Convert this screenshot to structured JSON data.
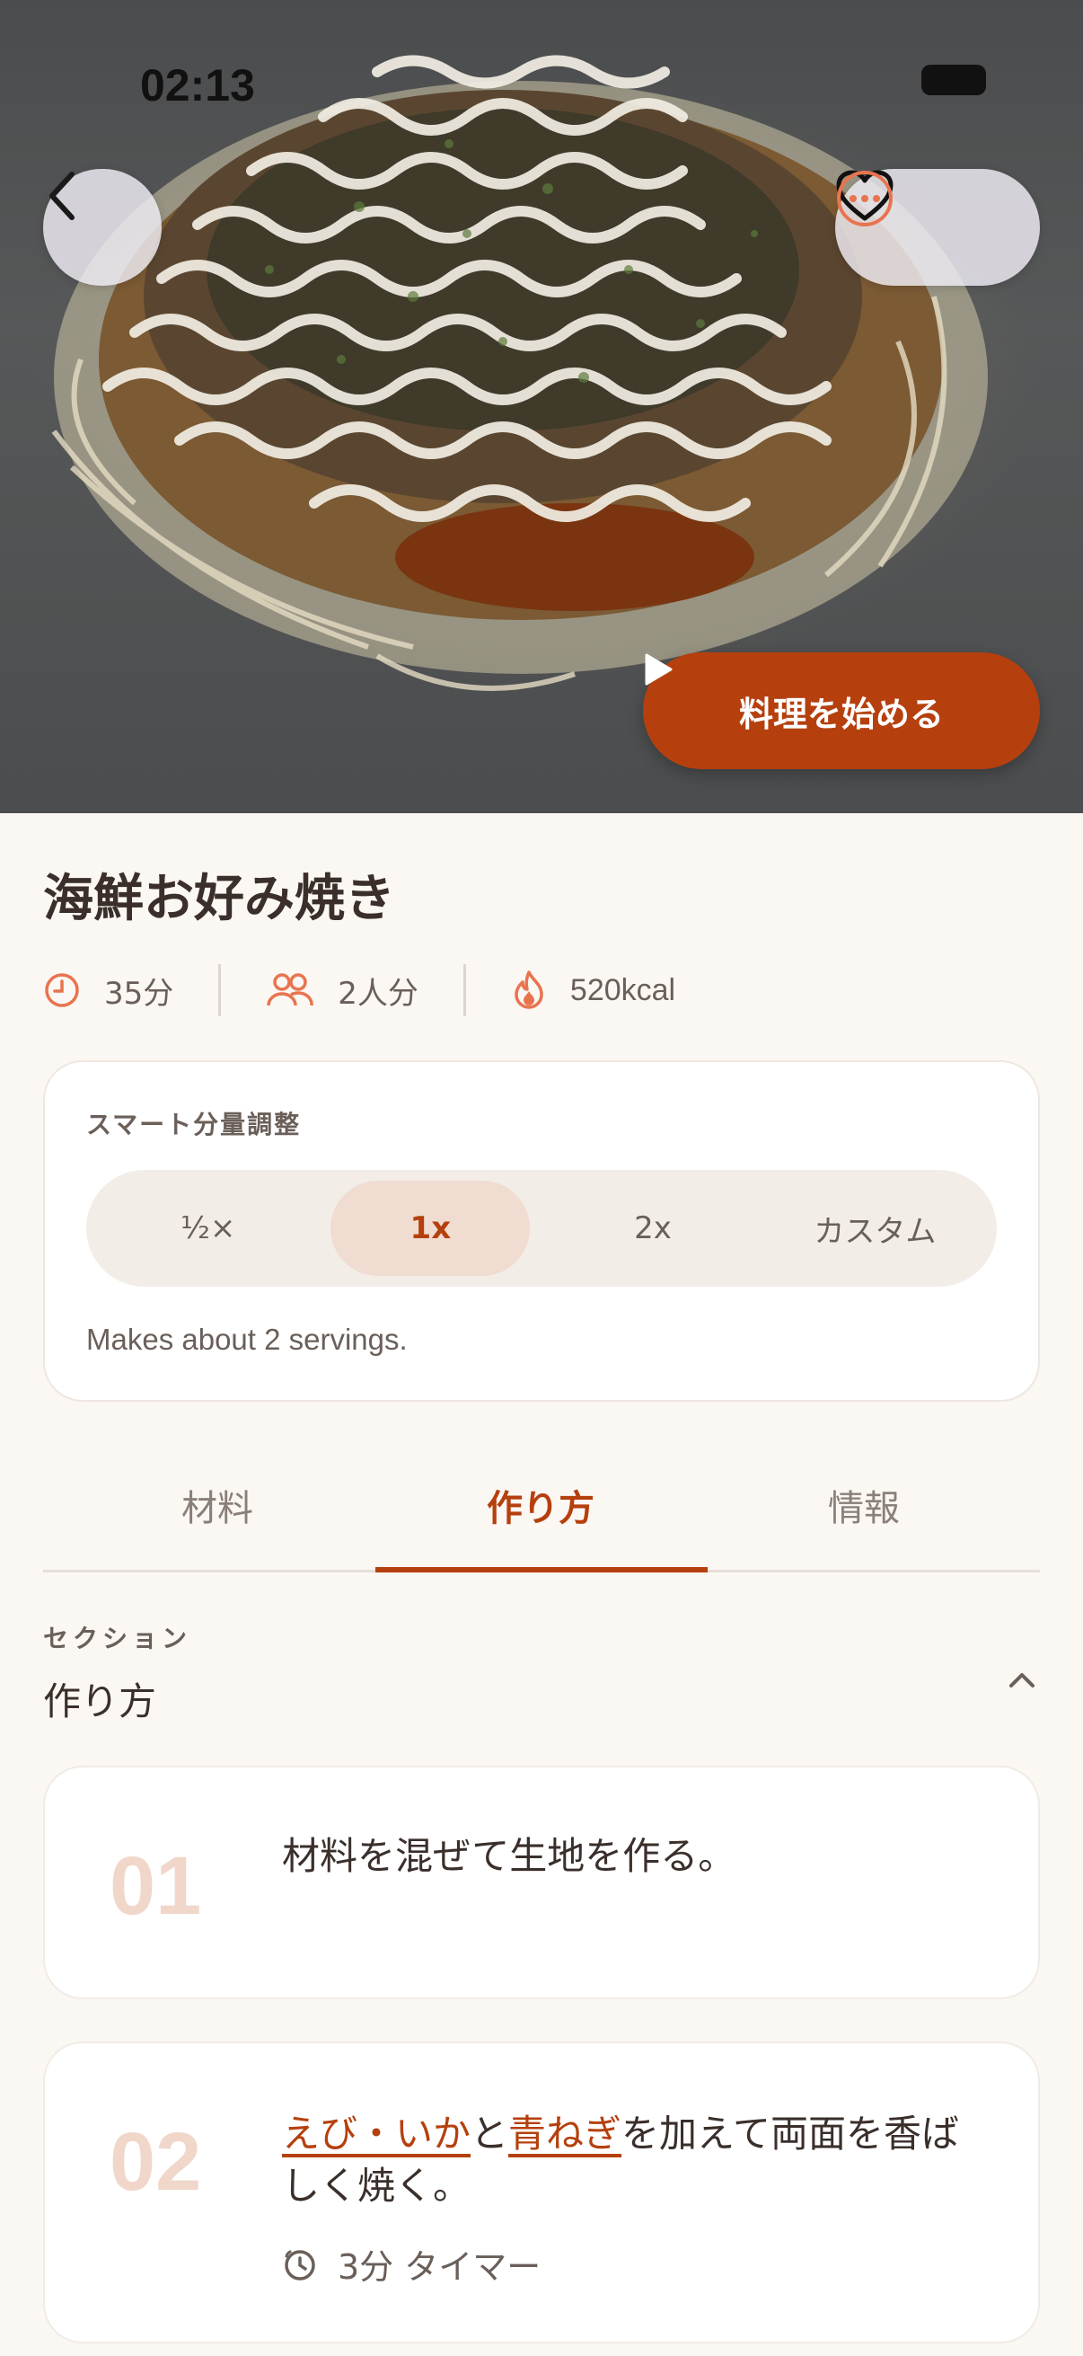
{
  "status_bar": {
    "time": "02:13"
  },
  "hero": {
    "start_button_label": "料理を始める"
  },
  "recipe": {
    "title": "海鮮お好み焼き",
    "meta": {
      "time": "35分",
      "servings": "2人分",
      "calories": "520kcal"
    }
  },
  "scaler": {
    "label": "スマート分量調整",
    "options": [
      "½×",
      "1x",
      "2x",
      "カスタム"
    ],
    "selected": "1x",
    "note": "Makes about 2 servings."
  },
  "tabs": {
    "items": [
      "材料",
      "作り方",
      "情報"
    ],
    "active": "作り方"
  },
  "section": {
    "kicker": "セクション",
    "title": "作り方"
  },
  "steps": [
    {
      "number": "01",
      "text": "材料を混ぜて生地を作る。"
    },
    {
      "number": "02",
      "link1": "えび・いか",
      "join": "と",
      "link2": "青ねぎ",
      "rest": "を加えて両面を香ばしく焼く。",
      "timer": "3分 タイマー"
    }
  ],
  "colors": {
    "accent": "#b5400e",
    "background": "#fbf7f3",
    "card": "#ffffff",
    "step_number": "#f0d7ca",
    "icon_orange": "#e8744f"
  }
}
